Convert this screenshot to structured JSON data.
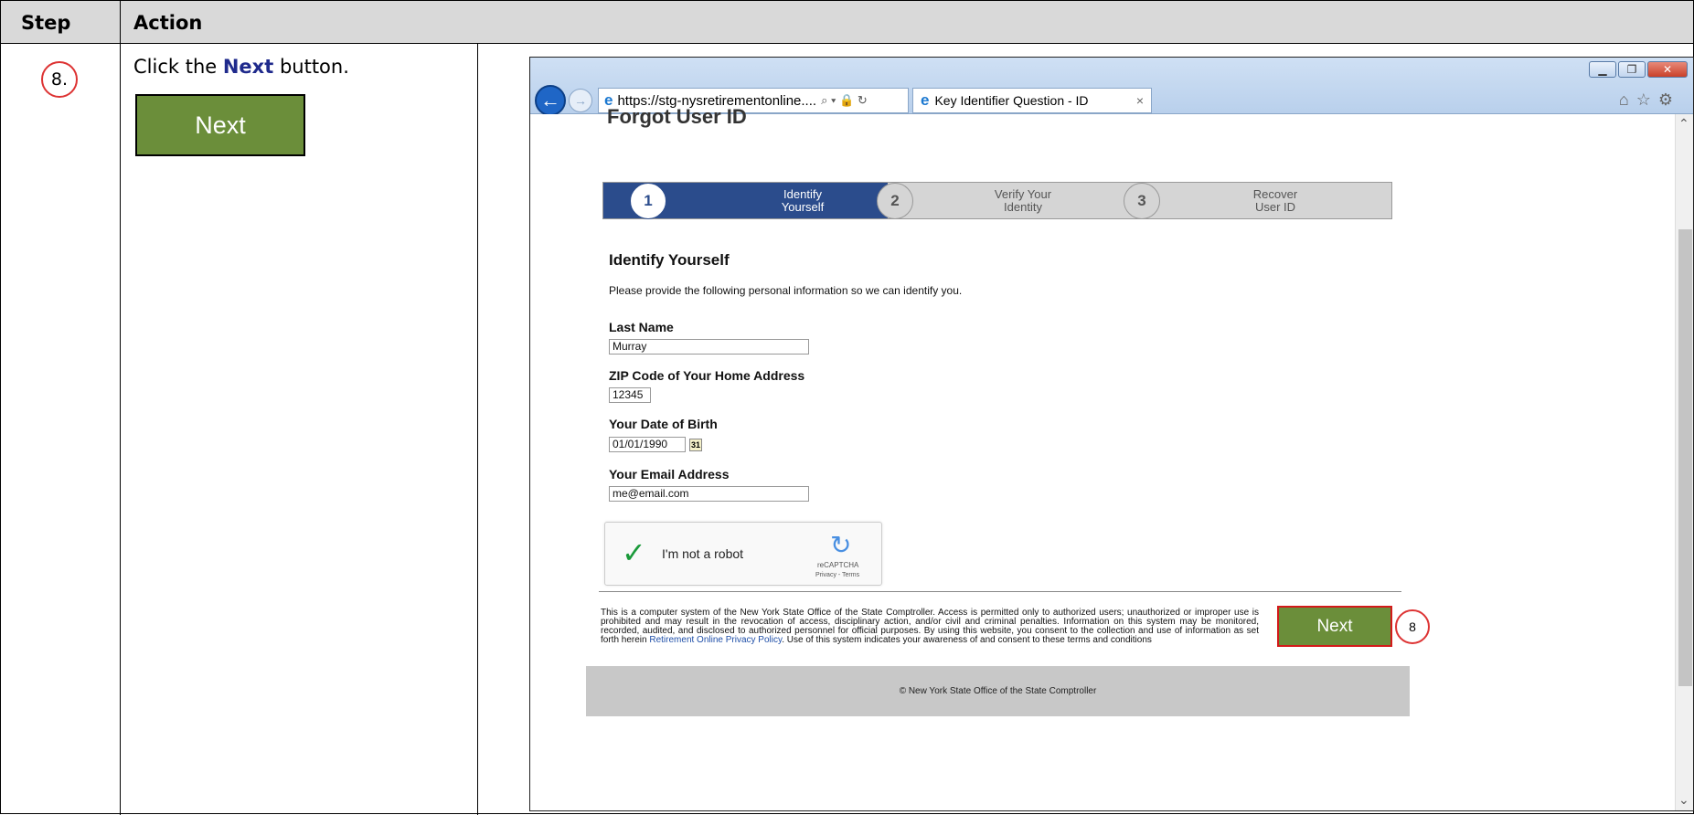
{
  "table": {
    "col_step": "Step",
    "col_action": "Action"
  },
  "row": {
    "step_number": "8.",
    "instruction_prefix": "Click the ",
    "instruction_bold": "Next",
    "instruction_suffix": " button.",
    "sample_button_label": "Next"
  },
  "browser": {
    "address": "https://stg-nysretirementonline....",
    "address_controls": "⌕ ▾ 🔒 ↻",
    "tab_title": "Key Identifier Question - ID",
    "tab_close": "×"
  },
  "page": {
    "title": "Forgot User ID",
    "steps": [
      {
        "number": "1",
        "line1": "Identify",
        "line2": "Yourself",
        "active": true
      },
      {
        "number": "2",
        "line1": "Verify Your",
        "line2": "Identity",
        "active": false
      },
      {
        "number": "3",
        "line1": "Recover",
        "line2": "User ID",
        "active": false
      }
    ],
    "section_title": "Identify Yourself",
    "section_desc": "Please provide the following personal information so we can identify you.",
    "fields": {
      "last_name_label": "Last Name",
      "last_name_value": "Murray",
      "zip_label": "ZIP Code of Your Home Address",
      "zip_value": "12345",
      "dob_label": "Your Date of Birth",
      "dob_value": "01/01/1990",
      "email_label": "Your Email Address",
      "email_value": "me@email.com"
    },
    "captcha": {
      "label": "I'm not a robot",
      "brand": "reCAPTCHA",
      "links": "Privacy - Terms"
    },
    "legal_prefix": "This is a computer system of the New York State Office of the State Comptroller. Access is permitted only to authorized users; unauthorized or improper use is prohibited and may result in the revocation of access, disciplinary action, and/or civil and criminal penalties. Information on this system may be monitored, recorded, audited, and disclosed to authorized personnel for official purposes. By using this website, you consent to the collection and use of information as set forth herein ",
    "legal_link": "Retirement Online Privacy Policy",
    "legal_suffix": ". Use of this system indicates your awareness of and consent to these terms and conditions",
    "next_label": "Next",
    "callout_number": "8",
    "footer": "© New York State Office of the State Comptroller"
  },
  "colors": {
    "next_green": "#6b8e3a",
    "active_step_blue": "#2b4c8c",
    "highlight_red": "#d31a1a"
  }
}
